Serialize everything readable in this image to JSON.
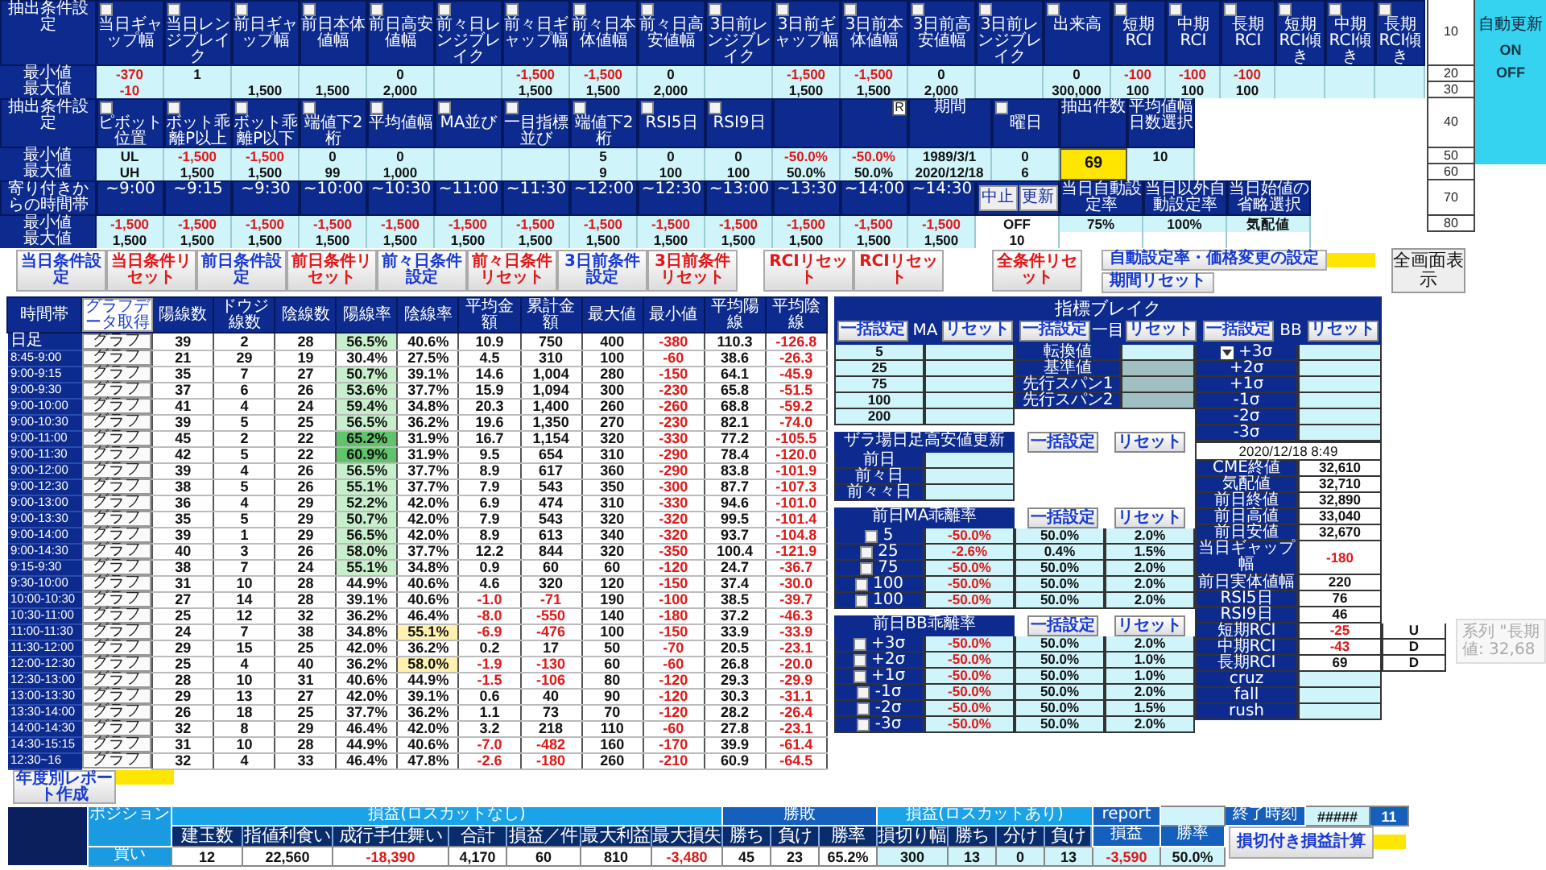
{
  "conditions": [
    {
      "label": "抽出条件設定",
      "min_label": "最小値",
      "max_label": "最大値",
      "columns": [
        {
          "kind": "normal",
          "header": "当日ギャップ幅",
          "checked": false,
          "min": "-370",
          "max": "-10"
        },
        {
          "kind": "normal",
          "header": "当日レンジブレイク",
          "checked": false,
          "min": "1"
        },
        {
          "kind": "normal",
          "header": "前日ギャップ幅",
          "checked": false,
          "max": "1,500"
        },
        {
          "kind": "normal",
          "header": "前日本体値幅",
          "checked": false,
          "max": "1,500"
        },
        {
          "kind": "normal",
          "header": "前日高安値幅",
          "checked": false,
          "min": "0",
          "max": "2,000"
        },
        {
          "kind": "normal",
          "header": "前々日レンジブレイク",
          "checked": false
        },
        {
          "kind": "normal",
          "header": "前々日ギャップ幅",
          "checked": false,
          "min": "-1,500",
          "max": "1,500"
        },
        {
          "kind": "normal",
          "header": "前々日本体値幅",
          "checked": false,
          "min": "-1,500",
          "max": "1,500"
        },
        {
          "kind": "normal",
          "header": "前々日高安値幅",
          "checked": false,
          "min": "0",
          "max": "2,000"
        },
        {
          "kind": "normal",
          "header": "3日前レンジブレイク",
          "checked": false
        },
        {
          "kind": "normal",
          "header": "3日前ギャップ幅",
          "checked": false,
          "min": "-1,500",
          "max": "1,500"
        },
        {
          "kind": "normal",
          "header": "3日前本体値幅",
          "checked": false,
          "min": "-1,500",
          "max": "1,500"
        },
        {
          "kind": "normal",
          "header": "3日前高安値幅",
          "checked": false,
          "min": "0",
          "max": "2,000"
        },
        {
          "kind": "normal",
          "header": "3日前レンジブレイク",
          "checked": false
        },
        {
          "kind": "normal",
          "header": "出来高",
          "checked": false,
          "min": "0",
          "max": "300,000"
        },
        {
          "kind": "rci",
          "header": "短期RCI",
          "checked": false,
          "min": "-100",
          "max": "100"
        },
        {
          "kind": "rci",
          "header": "中期RCI",
          "checked": false,
          "min": "-100",
          "max": "100"
        },
        {
          "kind": "rci",
          "header": "長期RCI",
          "checked": false,
          "min": "-100",
          "max": "100"
        },
        {
          "kind": "narrow",
          "header": "短期RCI傾き",
          "checked": false
        },
        {
          "kind": "narrow",
          "header": "中期RCI傾き",
          "checked": false
        },
        {
          "kind": "narrow",
          "header": "長期RCI傾き",
          "checked": false
        }
      ]
    },
    {
      "label": "抽出条件設定",
      "min_label": "最小値",
      "max_label": "最大値",
      "columns": [
        {
          "kind": "normal",
          "header": "ピボット位置",
          "checked": false,
          "min": "UL",
          "max": "UH"
        },
        {
          "kind": "normal",
          "header": "ボット乖離P以上",
          "checked": false,
          "min": "-1,500",
          "max": "1,500"
        },
        {
          "kind": "normal",
          "header": "ボット乖離P以下",
          "checked": false,
          "min": "-1,500",
          "max": "1,500"
        },
        {
          "kind": "normal",
          "header": "端値下2桁",
          "checked": false,
          "min": "0",
          "max": "99"
        },
        {
          "kind": "normal",
          "header": "平均値幅",
          "checked": false,
          "min": "0",
          "max": "1,000"
        },
        {
          "kind": "normal",
          "header": "MA並び",
          "checked": false
        },
        {
          "kind": "normal",
          "header": "一目指標並び",
          "checked": false
        },
        {
          "kind": "normal",
          "header": "端値下2桁",
          "checked": false,
          "min": "5",
          "max": "9"
        },
        {
          "kind": "normal",
          "header": "RSI5日",
          "checked": false,
          "min": "0",
          "max": "100"
        },
        {
          "kind": "normal",
          "header": "RSI9日",
          "checked": false,
          "min": "0",
          "max": "100"
        },
        {
          "kind": "normal",
          "min": "-50.0%",
          "max": "50.0%"
        },
        {
          "kind": "normal",
          "badge": "R",
          "min": "-50.0%",
          "max": "50.0%"
        },
        {
          "kind": "date",
          "header": "期間",
          "min": "1989/3/1",
          "max": "2020/12/18"
        },
        {
          "kind": "normal",
          "header": "曜日",
          "checked": false,
          "min": "0",
          "max": "6"
        },
        {
          "kind": "count",
          "header": "抽出件数",
          "min": "69"
        },
        {
          "kind": "normal",
          "header": "平均値幅日数選択",
          "min": "10"
        }
      ]
    },
    {
      "label": "寄り付きからの時間帯",
      "min_label": "最小値",
      "max_label": "最大値",
      "columns": [
        {
          "kind": "normal",
          "header": "~9:00",
          "min": "-1,500",
          "max": "1,500"
        },
        {
          "kind": "normal",
          "header": "~9:15",
          "min": "-1,500",
          "max": "1,500"
        },
        {
          "kind": "normal",
          "header": "~9:30",
          "min": "-1,500",
          "max": "1,500"
        },
        {
          "kind": "normal",
          "header": "~10:00",
          "min": "-1,500",
          "max": "1,500"
        },
        {
          "kind": "normal",
          "header": "~10:30",
          "min": "-1,500",
          "max": "1,500"
        },
        {
          "kind": "normal",
          "header": "~11:00",
          "min": "-1,500",
          "max": "1,500"
        },
        {
          "kind": "normal",
          "header": "~11:30",
          "min": "-1,500",
          "max": "1,500"
        },
        {
          "kind": "normal",
          "header": "~12:00",
          "min": "-1,500",
          "max": "1,500"
        },
        {
          "kind": "normal",
          "header": "~12:30",
          "min": "-1,500",
          "max": "1,500"
        },
        {
          "kind": "normal",
          "header": "~13:00",
          "min": "-1,500",
          "max": "1,500"
        },
        {
          "kind": "normal",
          "header": "~13:30",
          "min": "-1,500",
          "max": "1,500"
        },
        {
          "kind": "normal",
          "header": "~14:00",
          "min": "-1,500",
          "max": "1,500"
        },
        {
          "kind": "normal",
          "header": "~14:30",
          "min": "-1,500",
          "max": "1,500"
        },
        {
          "kind": "control",
          "buttons": [
            "中止",
            "更新"
          ],
          "min": "OFF",
          "max": "10"
        },
        {
          "kind": "wide",
          "header": "当日自動設定率",
          "min": "75%"
        },
        {
          "kind": "wide",
          "header": "当日以外自動設定率",
          "min": "100%"
        },
        {
          "kind": "wide",
          "header": "当日始値の省略選択",
          "min": "気配値"
        }
      ]
    }
  ],
  "interval_list": [
    "10",
    "20",
    "30",
    "40",
    "50",
    "60",
    "70",
    "80"
  ],
  "auto_update": {
    "title": "自動更新",
    "options": [
      "ON",
      "OFF"
    ]
  },
  "buttons": [
    {
      "label": "当日条件設定",
      "color": "#1a3ccf"
    },
    {
      "label": "当日条件リセット",
      "color": "#e01818"
    },
    {
      "label": "前日条件設定",
      "color": "#1a3ccf"
    },
    {
      "label": "前日条件リセット",
      "color": "#e01818"
    },
    {
      "label": "前々日条件設定",
      "color": "#1a3ccf"
    },
    {
      "label": "前々日条件リセット",
      "color": "#e01818"
    },
    {
      "label": "3日前条件設定",
      "color": "#1a3ccf"
    },
    {
      "label": "3日前条件リセット",
      "color": "#e01818"
    },
    {
      "label": "RCIリセット",
      "color": "#e01818"
    },
    {
      "label": "RCIリセット",
      "color": "#e01818"
    },
    {
      "label": "全条件リセット",
      "color": "#e01818"
    }
  ],
  "auto_rate_button": "自動設定率・価格変更の設定",
  "period_reset_button": "期間リセット",
  "fullscreen_button": "全画面表示",
  "stats": {
    "time_header": "時間帯",
    "graph_data_button": "グラフデータ取得",
    "columns": [
      "陽線数",
      "ドウジ線数",
      "陰線数",
      "陽線率",
      "陰線率",
      "平均金額",
      "累計金額",
      "最大値",
      "最小値",
      "平均陽線",
      "平均陰線"
    ],
    "rows": [
      {
        "time": "日足",
        "button": "グラフ",
        "cells": [
          "39",
          "2",
          "28",
          {
            "text": "56.5%",
            "color": "#c8efcc"
          },
          {
            "text": "40.6%",
            "color": "#ffffff"
          },
          "10.9",
          "750",
          "400",
          "-380",
          "110.3",
          "-126.8"
        ]
      },
      {
        "time": "8:45-9:00",
        "button": "グラフ",
        "cells": [
          "21",
          "29",
          "19",
          {
            "text": "30.4%",
            "color": "#ffffff"
          },
          {
            "text": "27.5%",
            "color": "#ffffff"
          },
          "4.5",
          "310",
          "100",
          "-60",
          "38.6",
          "-26.3"
        ]
      },
      {
        "time": "9:00-9:15",
        "button": "グラフ",
        "cells": [
          "35",
          "7",
          "27",
          {
            "text": "50.7%",
            "color": "#c8efcc"
          },
          {
            "text": "39.1%",
            "color": "#ffffff"
          },
          "14.6",
          "1,004",
          "280",
          "-150",
          "64.1",
          "-45.9"
        ]
      },
      {
        "time": "9:00-9:30",
        "button": "グラフ",
        "cells": [
          "37",
          "6",
          "26",
          {
            "text": "53.6%",
            "color": "#c8efcc"
          },
          {
            "text": "37.7%",
            "color": "#ffffff"
          },
          "15.9",
          "1,094",
          "300",
          "-230",
          "65.8",
          "-51.5"
        ]
      },
      {
        "time": "9:00-10:00",
        "button": "グラフ",
        "cells": [
          "41",
          "4",
          "24",
          {
            "text": "59.4%",
            "color": "#c8efcc"
          },
          {
            "text": "34.8%",
            "color": "#ffffff"
          },
          "20.3",
          "1,400",
          "260",
          "-260",
          "68.8",
          "-59.2"
        ]
      },
      {
        "time": "9:00-10:30",
        "button": "グラフ",
        "cells": [
          "39",
          "5",
          "25",
          {
            "text": "56.5%",
            "color": "#c8efcc"
          },
          {
            "text": "36.2%",
            "color": "#ffffff"
          },
          "19.6",
          "1,350",
          "270",
          "-230",
          "82.1",
          "-74.0"
        ]
      },
      {
        "time": "9:00-11:00",
        "button": "グラフ",
        "cells": [
          "45",
          "2",
          "22",
          {
            "text": "65.2%",
            "color": "#5fc46a"
          },
          {
            "text": "31.9%",
            "color": "#ffffff"
          },
          "16.7",
          "1,154",
          "320",
          "-330",
          "77.2",
          "-105.5"
        ]
      },
      {
        "time": "9:00-11:30",
        "button": "グラフ",
        "cells": [
          "42",
          "5",
          "22",
          {
            "text": "60.9%",
            "color": "#5fc46a"
          },
          {
            "text": "31.9%",
            "color": "#ffffff"
          },
          "9.5",
          "654",
          "310",
          "-290",
          "78.4",
          "-120.0"
        ]
      },
      {
        "time": "9:00-12:00",
        "button": "グラフ",
        "cells": [
          "39",
          "4",
          "26",
          {
            "text": "56.5%",
            "color": "#c8efcc"
          },
          {
            "text": "37.7%",
            "color": "#ffffff"
          },
          "8.9",
          "617",
          "360",
          "-290",
          "83.8",
          "-101.9"
        ]
      },
      {
        "time": "9:00-12:30",
        "button": "グラフ",
        "cells": [
          "38",
          "5",
          "26",
          {
            "text": "55.1%",
            "color": "#c8efcc"
          },
          {
            "text": "37.7%",
            "color": "#ffffff"
          },
          "7.9",
          "543",
          "350",
          "-300",
          "87.7",
          "-107.3"
        ]
      },
      {
        "time": "9:00-13:00",
        "button": "グラフ",
        "cells": [
          "36",
          "4",
          "29",
          {
            "text": "52.2%",
            "color": "#c8efcc"
          },
          {
            "text": "42.0%",
            "color": "#ffffff"
          },
          "6.9",
          "474",
          "310",
          "-330",
          "94.6",
          "-101.0"
        ]
      },
      {
        "time": "9:00-13:30",
        "button": "グラフ",
        "cells": [
          "35",
          "5",
          "29",
          {
            "text": "50.7%",
            "color": "#c8efcc"
          },
          {
            "text": "42.0%",
            "color": "#ffffff"
          },
          "7.9",
          "543",
          "320",
          "-320",
          "99.5",
          "-101.4"
        ]
      },
      {
        "time": "9:00-14:00",
        "button": "グラフ",
        "cells": [
          "39",
          "1",
          "29",
          {
            "text": "56.5%",
            "color": "#c8efcc"
          },
          {
            "text": "42.0%",
            "color": "#ffffff"
          },
          "8.9",
          "613",
          "340",
          "-320",
          "93.7",
          "-104.8"
        ]
      },
      {
        "time": "9:00-14:30",
        "button": "グラフ",
        "cells": [
          "40",
          "3",
          "26",
          {
            "text": "58.0%",
            "color": "#c8efcc"
          },
          {
            "text": "37.7%",
            "color": "#ffffff"
          },
          "12.2",
          "844",
          "320",
          "-350",
          "100.4",
          "-121.9"
        ]
      },
      {
        "time": "9:15-9:30",
        "button": "グラフ",
        "cells": [
          "38",
          "7",
          "24",
          {
            "text": "55.1%",
            "color": "#c8efcc"
          },
          {
            "text": "34.8%",
            "color": "#ffffff"
          },
          "0.9",
          "60",
          "60",
          "-120",
          "24.7",
          "-36.7"
        ]
      },
      {
        "time": "9:30-10:00",
        "button": "グラフ",
        "cells": [
          "31",
          "10",
          "28",
          {
            "text": "44.9%",
            "color": "#ffffff"
          },
          {
            "text": "40.6%",
            "color": "#ffffff"
          },
          "4.6",
          "320",
          "120",
          "-150",
          "37.4",
          "-30.0"
        ]
      },
      {
        "time": "10:00-10:30",
        "button": "グラフ",
        "cells": [
          "27",
          "14",
          "28",
          {
            "text": "39.1%",
            "color": "#ffffff"
          },
          {
            "text": "40.6%",
            "color": "#ffffff"
          },
          "-1.0",
          "-71",
          "190",
          "-100",
          "38.5",
          "-39.7"
        ]
      },
      {
        "time": "10:30-11:00",
        "button": "グラフ",
        "cells": [
          "25",
          "12",
          "32",
          {
            "text": "36.2%",
            "color": "#ffffff"
          },
          {
            "text": "46.4%",
            "color": "#ffffff"
          },
          "-8.0",
          "-550",
          "140",
          "-180",
          "37.2",
          "-46.3"
        ]
      },
      {
        "time": "11:00-11:30",
        "button": "グラフ",
        "cells": [
          "24",
          "7",
          "38",
          {
            "text": "34.8%",
            "color": "#ffffff"
          },
          {
            "text": "55.1%",
            "color": "#fff2b0"
          },
          "-6.9",
          "-476",
          "100",
          "-150",
          "33.9",
          "-33.9"
        ]
      },
      {
        "time": "11:30-12:00",
        "button": "グラフ",
        "cells": [
          "29",
          "15",
          "25",
          {
            "text": "42.0%",
            "color": "#ffffff"
          },
          {
            "text": "36.2%",
            "color": "#ffffff"
          },
          "0.2",
          "17",
          "50",
          "-70",
          "20.5",
          "-23.1"
        ]
      },
      {
        "time": "12:00-12:30",
        "button": "グラフ",
        "cells": [
          "25",
          "4",
          "40",
          {
            "text": "36.2%",
            "color": "#ffffff"
          },
          {
            "text": "58.0%",
            "color": "#fff2b0"
          },
          "-1.9",
          "-130",
          "60",
          "-60",
          "26.8",
          "-20.0"
        ]
      },
      {
        "time": "12:30-13:00",
        "button": "グラフ",
        "cells": [
          "28",
          "10",
          "31",
          {
            "text": "40.6%",
            "color": "#ffffff"
          },
          {
            "text": "44.9%",
            "color": "#ffffff"
          },
          "-1.5",
          "-106",
          "80",
          "-120",
          "29.3",
          "-29.9"
        ]
      },
      {
        "time": "13:00-13:30",
        "button": "グラフ",
        "cells": [
          "29",
          "13",
          "27",
          {
            "text": "42.0%",
            "color": "#ffffff"
          },
          {
            "text": "39.1%",
            "color": "#ffffff"
          },
          "0.6",
          "40",
          "90",
          "-120",
          "30.3",
          "-31.1"
        ]
      },
      {
        "time": "13:30-14:00",
        "button": "グラフ",
        "cells": [
          "26",
          "18",
          "25",
          {
            "text": "37.7%",
            "color": "#ffffff"
          },
          {
            "text": "36.2%",
            "color": "#ffffff"
          },
          "1.1",
          "73",
          "70",
          "-120",
          "28.2",
          "-26.4"
        ]
      },
      {
        "time": "14:00-14:30",
        "button": "グラフ",
        "cells": [
          "32",
          "8",
          "29",
          {
            "text": "46.4%",
            "color": "#ffffff"
          },
          {
            "text": "42.0%",
            "color": "#ffffff"
          },
          "3.2",
          "218",
          "110",
          "-60",
          "27.8",
          "-23.1"
        ]
      },
      {
        "time": "14:30-15:15",
        "button": "グラフ",
        "cells": [
          "31",
          "10",
          "28",
          {
            "text": "44.9%",
            "color": "#ffffff"
          },
          {
            "text": "40.6%",
            "color": "#ffffff"
          },
          "-7.0",
          "-482",
          "160",
          "-170",
          "39.9",
          "-61.4"
        ]
      },
      {
        "time": "12:30~16",
        "button": "グラフ",
        "cells": [
          "32",
          "4",
          "33",
          {
            "text": "46.4%",
            "color": "#ffffff"
          },
          {
            "text": "47.8%",
            "color": "#ffffff"
          },
          "-2.6",
          "-180",
          "260",
          "-210",
          "60.9",
          "-64.5"
        ]
      }
    ]
  },
  "indicator_break": {
    "title": "指標ブレイク",
    "groups": [
      {
        "label": "MA",
        "set_button": "一括設定",
        "reset_button": "リセット"
      },
      {
        "label": "一目",
        "set_button": "一括設定",
        "reset_button": "リセット"
      },
      {
        "label": "BB",
        "set_button": "一括設定",
        "reset_button": "リセット"
      }
    ],
    "ma_periods": [
      "5",
      "25",
      "75",
      "100",
      "200"
    ],
    "ichimoku": [
      {
        "label": "転換値",
        "disabled": false
      },
      {
        "label": "基準値",
        "disabled": true
      },
      {
        "label": "先行スパン1",
        "disabled": true
      },
      {
        "label": "先行スパン2",
        "disabled": true
      }
    ],
    "bb_levels": [
      "+3σ",
      "+2σ",
      "+1σ",
      "-1σ",
      "-2σ",
      "-3σ"
    ]
  },
  "intraday_update": {
    "title": "ザラ場日足高安値更新",
    "set_button": "一括設定",
    "reset_button": "リセット",
    "rows": [
      "前日",
      "前々日",
      "前々々日"
    ]
  },
  "ma_deviation": {
    "title": "前日MA乖離率",
    "set_button": "一括設定",
    "reset_button": "リセット",
    "rows": [
      {
        "label": "5",
        "checked": false,
        "values": [
          "-50.0%",
          "50.0%",
          "2.0%"
        ]
      },
      {
        "label": "25",
        "checked": false,
        "values": [
          "-2.6%",
          "0.4%",
          "1.5%"
        ]
      },
      {
        "label": "75",
        "checked": false,
        "values": [
          "-50.0%",
          "50.0%",
          "2.0%"
        ]
      },
      {
        "label": "100",
        "checked": false,
        "values": [
          "-50.0%",
          "50.0%",
          "2.0%"
        ]
      },
      {
        "label": "100",
        "checked": false,
        "values": [
          "-50.0%",
          "50.0%",
          "2.0%"
        ]
      }
    ]
  },
  "bb_deviation": {
    "title": "前日BB乖離率",
    "set_button": "一括設定",
    "reset_button": "リセット",
    "rows": [
      {
        "label": "+3σ",
        "checked": false,
        "values": [
          "-50.0%",
          "50.0%",
          "2.0%"
        ]
      },
      {
        "label": "+2σ",
        "checked": false,
        "values": [
          "-50.0%",
          "50.0%",
          "1.0%"
        ]
      },
      {
        "label": "+1σ",
        "checked": false,
        "values": [
          "-50.0%",
          "50.0%",
          "1.0%"
        ]
      },
      {
        "label": "-1σ",
        "checked": false,
        "values": [
          "-50.0%",
          "50.0%",
          "2.0%"
        ]
      },
      {
        "label": "-2σ",
        "checked": false,
        "values": [
          "-50.0%",
          "50.0%",
          "1.5%"
        ]
      },
      {
        "label": "-3σ",
        "checked": false,
        "values": [
          "-50.0%",
          "50.0%",
          "2.0%"
        ]
      }
    ]
  },
  "market_info": {
    "timestamp": "2020/12/18 8:49",
    "rows": [
      {
        "label": "CME終値",
        "value": "32,610"
      },
      {
        "label": "気配値",
        "value": "32,710"
      },
      {
        "label": "前日終値",
        "value": "32,890"
      },
      {
        "label": "前日高値",
        "value": "33,040"
      },
      {
        "label": "前日安値",
        "value": "32,670"
      },
      {
        "label": "当日ギャップ幅",
        "value": "-180"
      },
      {
        "label": "前日実体値幅",
        "value": "220"
      },
      {
        "label": "RSI5日",
        "value": "76"
      },
      {
        "label": "RSI9日",
        "value": "46"
      },
      {
        "label": "短期RCI",
        "value": "-25",
        "trend": "U"
      },
      {
        "label": "中期RCI",
        "value": "-43",
        "trend": "D"
      },
      {
        "label": "長期RCI",
        "value": "69",
        "trend": "D"
      },
      {
        "label": "cruz"
      },
      {
        "label": "fall"
      },
      {
        "label": "rush"
      }
    ]
  },
  "tooltip": {
    "lines": [
      "系列 \"長期",
      "値: 32,68"
    ]
  },
  "report_button": "年度別レポート作成",
  "results": {
    "position_header": "ポジション",
    "groups": [
      {
        "title": "損益(ロスカットなし)",
        "columns": [
          "建玉数",
          "指値利食い",
          "成行手仕舞い",
          "合計",
          "損益／件",
          "最大利益",
          "最大損失"
        ]
      },
      {
        "title": "勝敗",
        "columns": [
          "勝ち",
          "負け",
          "勝率"
        ]
      },
      {
        "title": "損益(ロスカットあり)",
        "columns": [
          "損切り幅",
          "勝ち",
          "分け",
          "負け"
        ]
      }
    ],
    "report_label": "report",
    "extra_columns": [
      "損益",
      "勝率"
    ],
    "end_time_label": "終了時刻",
    "end_time_value": "#####",
    "end_time_count": "11",
    "calc_button": "損切付き損益計算",
    "rows": [
      {
        "position": "買い",
        "values": [
          "12",
          "22,560",
          "-18,390",
          "4,170",
          "60",
          "810",
          "-3,480",
          "45",
          "23",
          "65.2%",
          "300",
          "13",
          "0",
          "13",
          "-3,590",
          "50.0%"
        ]
      }
    ]
  }
}
